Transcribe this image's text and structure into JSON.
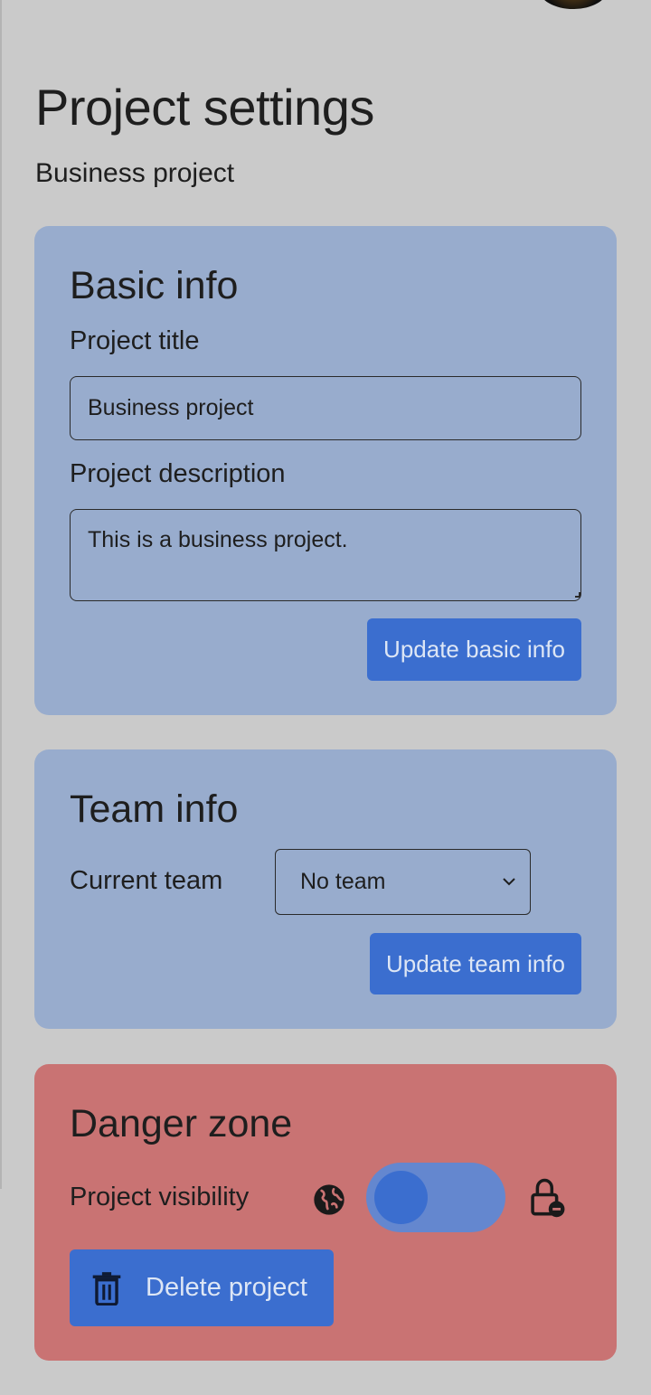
{
  "page": {
    "title": "Project settings",
    "subtitle": "Business project"
  },
  "basic_info": {
    "heading": "Basic info",
    "title_label": "Project title",
    "title_value": "Business project",
    "description_label": "Project description",
    "description_value": "This is a business project.",
    "update_button": "Update basic info"
  },
  "team_info": {
    "heading": "Team info",
    "team_label": "Current team",
    "team_selected": "No team",
    "update_button": "Update team info"
  },
  "danger_zone": {
    "heading": "Danger zone",
    "visibility_label": "Project visibility",
    "visibility_public_icon": "globe-icon",
    "visibility_private_icon": "lock-icon",
    "visibility_private": false,
    "delete_button": "Delete project",
    "delete_icon": "trash-icon"
  },
  "colors": {
    "card_blue": "#98accd",
    "card_red": "#c97373",
    "primary_button": "#3b6ecf",
    "background": "#cacaca"
  }
}
